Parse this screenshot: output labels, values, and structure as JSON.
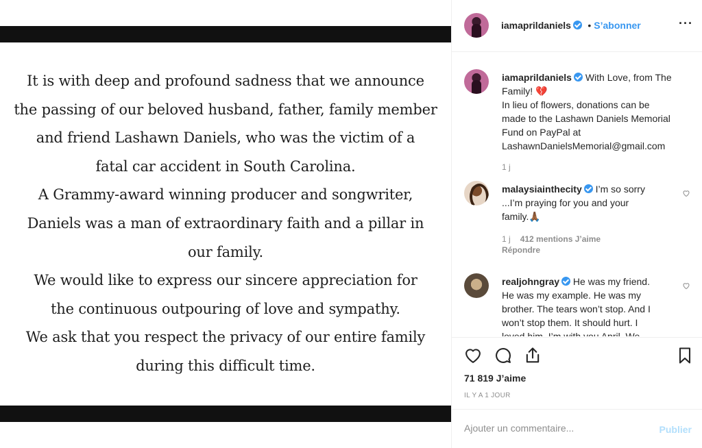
{
  "post": {
    "announcement_lines": [
      "It is with deep and profound sadness that we announce",
      "the passing of our beloved husband, father, family member",
      "and friend Lashawn Daniels, who was the victim of a",
      "fatal car accident in South Carolina.",
      "A Grammy-award winning producer and songwriter,",
      "Daniels was a man of extraordinary faith and a pillar in",
      "our family.",
      "We would like to express our sincere appreciation for",
      "the continuous outpouring of love and sympathy.",
      "We ask that you respect the privacy of our entire family",
      "during this difficult time."
    ]
  },
  "header": {
    "username": "iamaprildaniels",
    "separator": "•",
    "follow_label": "S’abonner",
    "more_label": "···"
  },
  "caption": {
    "username": "iamaprildaniels",
    "text_line1": "With Love, from The",
    "text_line2": "Family! 💔",
    "text_line3": "In lieu of flowers, donations can be",
    "text_line4": "made to the Lashawn Daniels Memorial",
    "text_line5": "Fund on PayPal at",
    "text_line6": "LashawnDanielsMemorial@gmail.com",
    "time": "1 j"
  },
  "comments": [
    {
      "username": "malaysiainthecity",
      "line1": "I’m so sorry",
      "line2": "...I’m praying for you and your",
      "line3": "family.🙏🏾",
      "time": "1 j",
      "likes": "412 mentions J’aime",
      "reply": "Répondre"
    },
    {
      "username": "realjohngray",
      "line1": "He was my friend.",
      "line2": "He was my example. He was my",
      "line3": "brother. The tears won’t stop. And I",
      "line4": "won’t stop them. It should hurt. I",
      "line5": "loved him. I’m with you April. We"
    }
  ],
  "actions": {
    "likes_count": "71 819 J’aime",
    "timestamp": "IL Y A 1 JOUR"
  },
  "add_comment": {
    "placeholder": "Ajouter un commentaire...",
    "publish_label": "Publier"
  },
  "colors": {
    "accent": "#3897f0",
    "muted": "#8e8e8e",
    "publish_disabled": "#b2dffc"
  },
  "icons": [
    "verified-badge-icon",
    "more-options-icon",
    "heart-icon",
    "comment-icon",
    "share-icon",
    "bookmark-icon"
  ]
}
